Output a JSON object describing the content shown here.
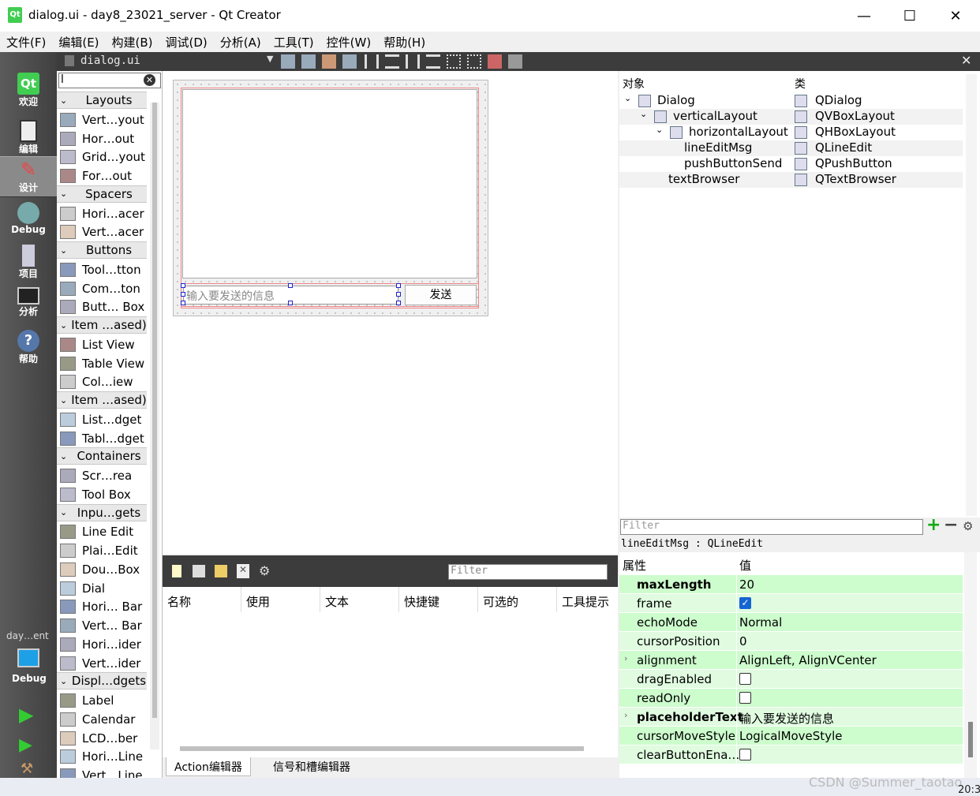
{
  "window": {
    "title": "dialog.ui - day8_23021_server - Qt Creator",
    "controls": [
      "—",
      "☐",
      "✕"
    ]
  },
  "menu": [
    "文件(F)",
    "编辑(E)",
    "构建(B)",
    "调试(D)",
    "分析(A)",
    "工具(T)",
    "控件(W)",
    "帮助(H)"
  ],
  "modes": [
    {
      "label": "欢迎",
      "icon": "qt-logo-icon"
    },
    {
      "label": "编辑",
      "icon": "document-icon"
    },
    {
      "label": "设计",
      "icon": "pencil-icon",
      "active": true
    },
    {
      "label": "Debug",
      "icon": "bug-icon"
    },
    {
      "label": "项目",
      "icon": "folder-icon"
    },
    {
      "label": "分析",
      "icon": "monitor-chart-icon"
    },
    {
      "label": "帮助",
      "icon": "help-icon"
    }
  ],
  "kit": {
    "project": "day…ent",
    "config": "Debug"
  },
  "editor": {
    "document": "dialog.ui"
  },
  "widgetbox": {
    "filter": "l",
    "rows": [
      {
        "type": "cat",
        "label": "Layouts"
      },
      {
        "type": "item",
        "label": "Vert…yout"
      },
      {
        "type": "item",
        "label": "Hor…out"
      },
      {
        "type": "item",
        "label": "Grid…yout"
      },
      {
        "type": "item",
        "label": "For…out"
      },
      {
        "type": "cat",
        "label": "Spacers"
      },
      {
        "type": "item",
        "label": "Hori…acer"
      },
      {
        "type": "item",
        "label": "Vert…acer"
      },
      {
        "type": "cat",
        "label": "Buttons"
      },
      {
        "type": "item",
        "label": "Tool…tton"
      },
      {
        "type": "item",
        "label": "Com…ton"
      },
      {
        "type": "item",
        "label": "Butt… Box"
      },
      {
        "type": "cat",
        "label": "Item …ased)"
      },
      {
        "type": "item",
        "label": "List View"
      },
      {
        "type": "item",
        "label": "Table View"
      },
      {
        "type": "item",
        "label": "Col…iew"
      },
      {
        "type": "cat",
        "label": "Item …ased)"
      },
      {
        "type": "item",
        "label": "List…dget"
      },
      {
        "type": "item",
        "label": "Tabl…dget"
      },
      {
        "type": "cat",
        "label": "Containers"
      },
      {
        "type": "item",
        "label": "Scr…rea"
      },
      {
        "type": "item",
        "label": "Tool Box"
      },
      {
        "type": "cat",
        "label": "Inpu…gets"
      },
      {
        "type": "item",
        "label": "Line Edit"
      },
      {
        "type": "item",
        "label": "Plai…Edit"
      },
      {
        "type": "item",
        "label": "Dou…Box"
      },
      {
        "type": "item",
        "label": "Dial"
      },
      {
        "type": "item",
        "label": "Hori… Bar"
      },
      {
        "type": "item",
        "label": "Vert… Bar"
      },
      {
        "type": "item",
        "label": "Hori…ider"
      },
      {
        "type": "item",
        "label": "Vert…ider"
      },
      {
        "type": "cat",
        "label": "Displ…dgets"
      },
      {
        "type": "item",
        "label": "Label"
      },
      {
        "type": "item",
        "label": "Calendar"
      },
      {
        "type": "item",
        "label": "LCD…ber"
      },
      {
        "type": "item",
        "label": "Hori…Line"
      },
      {
        "type": "item",
        "label": "Vert…Line"
      }
    ]
  },
  "form": {
    "lineedit_placeholder": "输入要发送的信息",
    "button_label": "发送"
  },
  "action_editor": {
    "filter_placeholder": "Filter",
    "columns": [
      "名称",
      "使用",
      "文本",
      "快捷键",
      "可选的",
      "工具提示"
    ],
    "tabs": [
      "Action编辑器",
      "信号和槽编辑器"
    ]
  },
  "object_inspector": {
    "col_object": "对象",
    "col_class": "类",
    "rows": [
      {
        "name": "Dialog",
        "class": "QDialog",
        "arrow": "v"
      },
      {
        "name": "verticalLayout",
        "class": "QVBoxLayout",
        "arrow": "v"
      },
      {
        "name": "horizontalLayout",
        "class": "QHBoxLayout",
        "arrow": "v"
      },
      {
        "name": "lineEditMsg",
        "class": "QLineEdit",
        "arrow": ""
      },
      {
        "name": "pushButtonSend",
        "class": "QPushButton",
        "arrow": ""
      },
      {
        "name": "textBrowser",
        "class": "QTextBrowser",
        "arrow": ""
      }
    ]
  },
  "property_editor": {
    "filter_placeholder": "Filter",
    "object_label": "lineEditMsg : QLineEdit",
    "col_property": "属性",
    "col_value": "值",
    "rows": [
      {
        "name": "maxLength",
        "value": "20",
        "bold": true
      },
      {
        "name": "frame",
        "check": true
      },
      {
        "name": "echoMode",
        "value": "Normal"
      },
      {
        "name": "cursorPosition",
        "value": "0"
      },
      {
        "name": "alignment",
        "value": "AlignLeft, AlignVCenter",
        "expand": true
      },
      {
        "name": "dragEnabled",
        "check": false
      },
      {
        "name": "readOnly",
        "check": false
      },
      {
        "name": "placeholderText",
        "value": "输入要发送的信息",
        "bold": true,
        "expand": true
      },
      {
        "name": "cursorMoveStyle",
        "value": "LogicalMoveStyle"
      },
      {
        "name": "clearButtonEna…",
        "check": false
      }
    ]
  },
  "taskbar": {
    "watermark": "CSDN @Summer_taotao",
    "clock": "20:3"
  }
}
